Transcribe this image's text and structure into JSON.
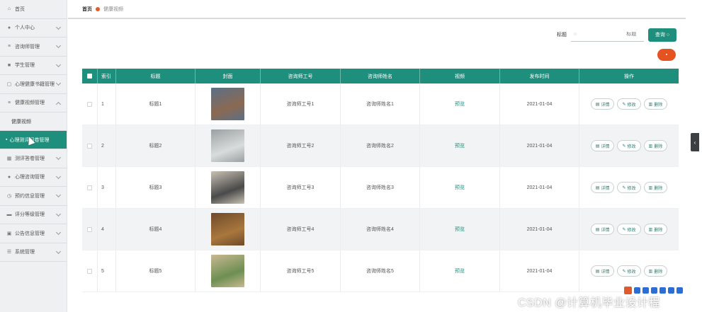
{
  "sidebar": {
    "items": [
      {
        "label": "首页",
        "icon": "home-icon",
        "glyph": "⌂",
        "chevron": false
      },
      {
        "label": "个人中心",
        "icon": "user-icon",
        "glyph": "●",
        "chevron": true
      },
      {
        "label": "咨询师管理",
        "icon": "list-icon",
        "glyph": "≡",
        "chevron": true
      },
      {
        "label": "学生管理",
        "icon": "student-icon",
        "glyph": "■",
        "chevron": true
      },
      {
        "label": "心理健康书籍管理",
        "icon": "book-icon",
        "glyph": "▢",
        "chevron": true
      },
      {
        "label": "健康视频管理",
        "icon": "video-icon",
        "glyph": "≡",
        "chevron": "up"
      }
    ],
    "sub_items": [
      {
        "label": "健康视频",
        "active": false
      },
      {
        "label": "心理测评问卷管理",
        "active": true
      }
    ],
    "items_after": [
      {
        "label": "测评答卷管理",
        "icon": "grid-icon",
        "glyph": "▦"
      },
      {
        "label": "心理咨询管理",
        "icon": "person-icon",
        "glyph": "●"
      },
      {
        "label": "预约信息管理",
        "icon": "calendar-icon",
        "glyph": "◷"
      },
      {
        "label": "评分等级管理",
        "icon": "rating-icon",
        "glyph": "▬"
      },
      {
        "label": "公告信息管理",
        "icon": "notice-icon",
        "glyph": "▣"
      },
      {
        "label": "系统管理",
        "icon": "settings-icon",
        "glyph": "☰"
      }
    ]
  },
  "breadcrumb": {
    "home": "首页",
    "current": "健康视频"
  },
  "search": {
    "label": "标题",
    "placeholder": "标题",
    "button": "查询"
  },
  "table": {
    "headers": [
      "索引",
      "标题",
      "封面",
      "咨询师工号",
      "咨询师姓名",
      "视频",
      "发布时间",
      "操作"
    ],
    "rows": [
      {
        "index": "1",
        "title": "标题1",
        "cover_color": "#8a6a52",
        "cover_color2": "#5b6f86",
        "consultant_id": "咨询师工号1",
        "consultant_name": "咨询师姓名1",
        "video": "预览",
        "date": "2021-01-04"
      },
      {
        "index": "2",
        "title": "标题2",
        "cover_color": "#d9dcdc",
        "cover_color2": "#9aa0a2",
        "consultant_id": "咨询师工号2",
        "consultant_name": "咨询师姓名2",
        "video": "预览",
        "date": "2021-01-04"
      },
      {
        "index": "3",
        "title": "标题3",
        "cover_color": "#4a4a4a",
        "cover_color2": "#c9c2b4",
        "consultant_id": "咨询师工号3",
        "consultant_name": "咨询师姓名3",
        "video": "预览",
        "date": "2021-01-04"
      },
      {
        "index": "4",
        "title": "标题4",
        "cover_color": "#a9773e",
        "cover_color2": "#6e4a2a",
        "consultant_id": "咨询师工号4",
        "consultant_name": "咨询师姓名4",
        "video": "预览",
        "date": "2021-01-04"
      },
      {
        "index": "5",
        "title": "标题5",
        "cover_color": "#6d8f52",
        "cover_color2": "#c9b892",
        "consultant_id": "咨询师工号5",
        "consultant_name": "咨询师姓名5",
        "video": "预览",
        "date": "2021-01-04"
      }
    ],
    "actions": {
      "detail": "详情",
      "edit": "修改",
      "delete": "删除"
    }
  },
  "watermark": "CSDN @计算机毕业设计程",
  "colors": {
    "accent": "#1f8f7d",
    "danger": "#e45320"
  }
}
